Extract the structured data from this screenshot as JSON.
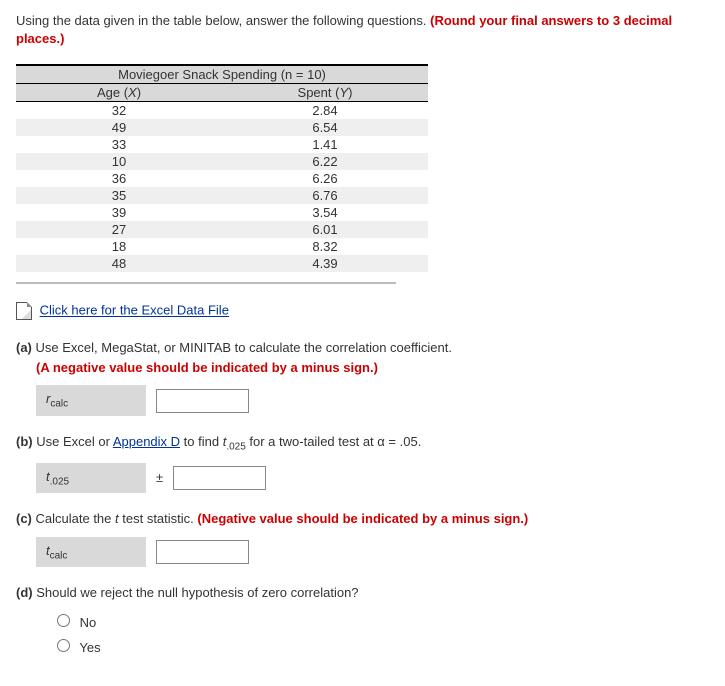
{
  "intro": {
    "text": "Using the data given in the table below, answer the following questions.",
    "round_note": "(Round your final answers to 3 decimal places.)"
  },
  "chart_data": {
    "type": "table",
    "title": "Moviegoer Snack Spending (n = 10)",
    "columns": [
      "Age (X)",
      "Spent (Y)"
    ],
    "rows": [
      {
        "x": "32",
        "y": "2.84"
      },
      {
        "x": "49",
        "y": "6.54"
      },
      {
        "x": "33",
        "y": "1.41"
      },
      {
        "x": "10",
        "y": "6.22"
      },
      {
        "x": "36",
        "y": "6.26"
      },
      {
        "x": "35",
        "y": "6.76"
      },
      {
        "x": "39",
        "y": "3.54"
      },
      {
        "x": "27",
        "y": "6.01"
      },
      {
        "x": "18",
        "y": "8.32"
      },
      {
        "x": "48",
        "y": "4.39"
      }
    ]
  },
  "link_excel": "Click here for the Excel Data File",
  "link_appendix": "Appendix D",
  "qa": {
    "label": "(a)",
    "text": "Use Excel, MegaStat, or MINITAB to calculate the correlation coefficient.",
    "note": "(A negative value should be indicated by a minus sign.)",
    "input_label_var": "r",
    "input_label_sub": "calc"
  },
  "qb": {
    "label": "(b)",
    "text_before": "Use Excel or ",
    "text_mid": " to find ",
    "t_sub": ".025",
    "text_after": " for a two-tailed test at α = .05.",
    "input_label_var": "t",
    "input_label_sub": ".025",
    "pm": "±"
  },
  "qc": {
    "label": "(c)",
    "text_before": "Calculate the ",
    "t_var": "t",
    "text_after": " test statistic.",
    "note": "(Negative value should be indicated by a minus sign.)",
    "input_label_var": "t",
    "input_label_sub": "calc"
  },
  "qd": {
    "label": "(d)",
    "text": "Should we reject the null hypothesis of zero correlation?",
    "opt_no": "No",
    "opt_yes": "Yes"
  }
}
